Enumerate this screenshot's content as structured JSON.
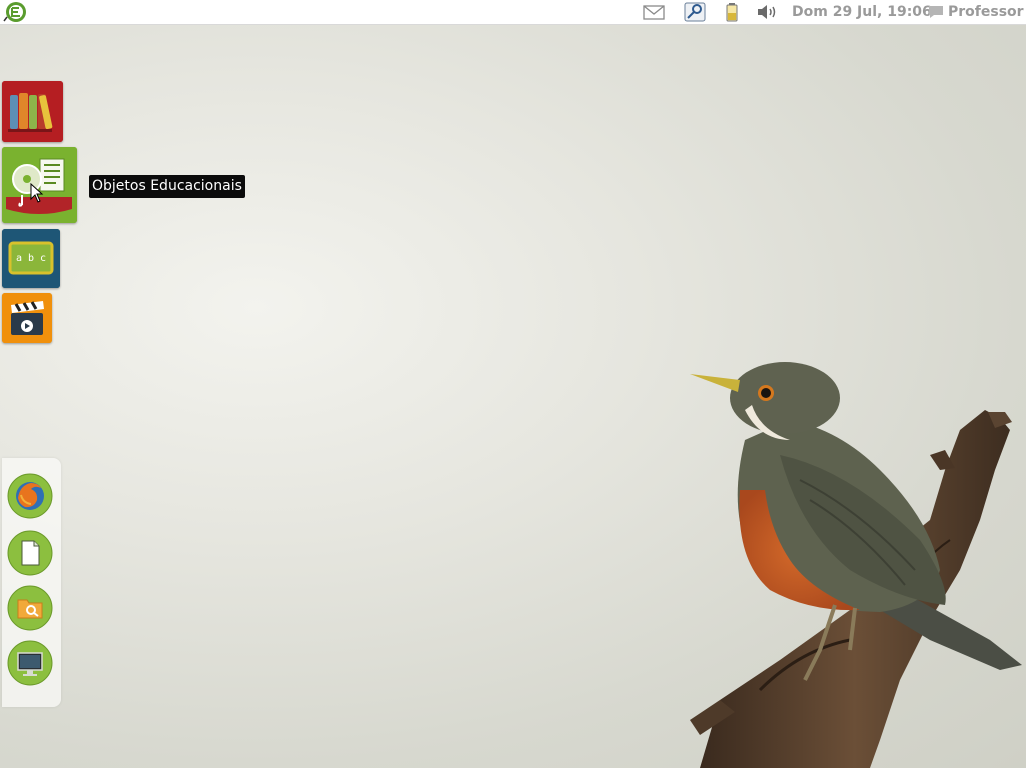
{
  "top_panel": {
    "logo_icon": "linux-educacional-logo",
    "tray": [
      {
        "name": "mail-icon"
      },
      {
        "name": "network-key-icon"
      },
      {
        "name": "battery-icon"
      },
      {
        "name": "volume-icon"
      }
    ],
    "clock": "Dom 29 Jul, 19:06",
    "user": "Professor",
    "user_icon": "chat-bubble-icon"
  },
  "launcher": {
    "tiles": [
      {
        "name": "library-books-icon",
        "color": "#b51e22"
      },
      {
        "name": "educational-objects-icon",
        "color": "#7ab22f"
      },
      {
        "name": "literacy-board-icon",
        "color": "#1e5676"
      },
      {
        "name": "video-clapper-icon",
        "color": "#f0900c"
      }
    ],
    "tooltip": "Objetos Educacionais"
  },
  "dock": {
    "items": [
      {
        "name": "firefox-icon"
      },
      {
        "name": "document-icon"
      },
      {
        "name": "file-search-icon"
      },
      {
        "name": "monitor-icon"
      }
    ],
    "accent": "#8cbf3f"
  },
  "wallpaper": {
    "subject": "bird-on-branch"
  }
}
